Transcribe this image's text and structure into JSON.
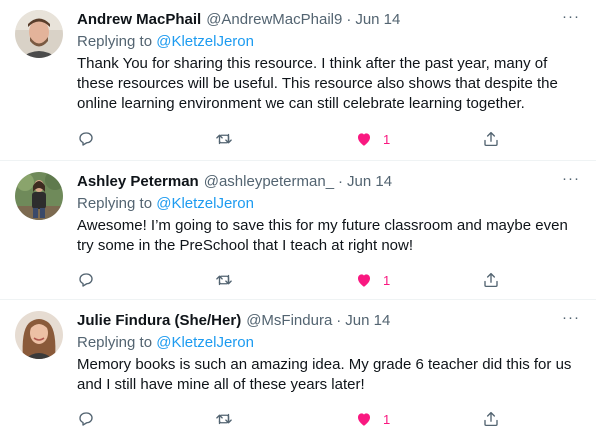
{
  "tweets": [
    {
      "name": "Andrew MacPhail",
      "handle": "@AndrewMacPhail9",
      "time": "Jun 14",
      "replying_prefix": "Replying to ",
      "replying_to": "@KletzelJeron",
      "body": "Thank You for sharing this resource. I think after the past year, many of these resources will be useful. This resource also shows that despite the online learning environment we can still celebrate learning together.",
      "likes": "1"
    },
    {
      "name": "Ashley Peterman",
      "handle": "@ashleypeterman_",
      "time": "Jun 14",
      "replying_prefix": "Replying to ",
      "replying_to": "@KletzelJeron",
      "body": "Awesome! I’m going to save this for my future classroom and maybe even try some in the PreSchool that I teach at right now!",
      "likes": "1"
    },
    {
      "name": "Julie Findura (She/Her)",
      "handle": "@MsFindura",
      "time": "Jun 14",
      "replying_prefix": "Replying to ",
      "replying_to": "@KletzelJeron",
      "body": "Memory books is such an amazing idea. My grade 6 teacher did this for us and I still have mine all of these years later!",
      "likes": "1"
    }
  ],
  "colors": {
    "text": "#0f1419",
    "muted": "#536471",
    "link": "#1d9bf0",
    "like": "#f91880",
    "divider": "#eff3f4"
  },
  "icons": [
    "more-icon",
    "reply-icon",
    "retweet-icon",
    "like-icon",
    "share-icon"
  ]
}
